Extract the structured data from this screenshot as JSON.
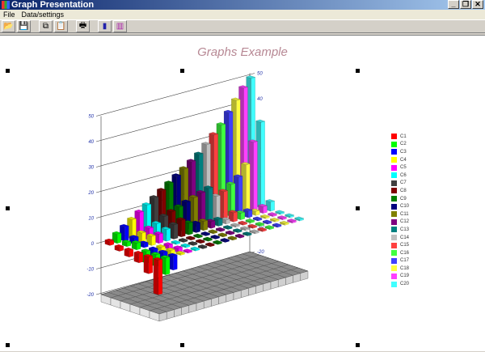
{
  "window": {
    "title": "Graph Presentation",
    "min": "_",
    "max": "❐",
    "close": "✕"
  },
  "menu": [
    "File",
    "Data/settings"
  ],
  "toolbar": [
    {
      "name": "open-icon",
      "glyph": "📂"
    },
    {
      "name": "save-icon",
      "glyph": "💾"
    },
    {
      "name": "copy-icon",
      "glyph": "⧉"
    },
    {
      "name": "paste-icon",
      "glyph": "📋"
    },
    {
      "name": "print-icon",
      "glyph": "🖶"
    },
    {
      "name": "bar-chart-3d-icon",
      "glyph": "▮"
    },
    {
      "name": "bar-chart-icon",
      "glyph": "▥"
    }
  ],
  "chart_data": {
    "type": "bar3d",
    "title": "Graphs Example",
    "ylim": [
      -20,
      50
    ],
    "yticks": [
      50,
      40,
      30,
      20,
      10,
      0,
      -10,
      -20
    ],
    "series": [
      {
        "name": "C1",
        "color": "#ff0000"
      },
      {
        "name": "C2",
        "color": "#00ff00"
      },
      {
        "name": "C3",
        "color": "#0000ff"
      },
      {
        "name": "C4",
        "color": "#ffff00"
      },
      {
        "name": "C5",
        "color": "#ff00ff"
      },
      {
        "name": "C6",
        "color": "#00ffff"
      },
      {
        "name": "C7",
        "color": "#404040"
      },
      {
        "name": "C8",
        "color": "#800000"
      },
      {
        "name": "C9",
        "color": "#008000"
      },
      {
        "name": "C10",
        "color": "#000080"
      },
      {
        "name": "C11",
        "color": "#808000"
      },
      {
        "name": "C12",
        "color": "#800080"
      },
      {
        "name": "C13",
        "color": "#008080"
      },
      {
        "name": "C14",
        "color": "#c0c0c0"
      },
      {
        "name": "C15",
        "color": "#ff4040"
      },
      {
        "name": "C16",
        "color": "#40ff40"
      },
      {
        "name": "C17",
        "color": "#4040ff"
      },
      {
        "name": "C18",
        "color": "#ffff40"
      },
      {
        "name": "C19",
        "color": "#ff40ff"
      },
      {
        "name": "C20",
        "color": "#40ffff"
      }
    ],
    "rows": [
      [
        1,
        3,
        5,
        7,
        9,
        11,
        13,
        15,
        17,
        19,
        21,
        23,
        25,
        28,
        31,
        34,
        38,
        42,
        46,
        49
      ],
      [
        -1,
        1,
        2,
        3,
        4,
        5,
        7,
        8,
        9,
        10,
        11,
        12,
        13,
        9,
        10,
        12,
        14,
        18,
        26,
        33
      ],
      [
        -2,
        2,
        1,
        3,
        3,
        4,
        5,
        6,
        4,
        3,
        3,
        2,
        2,
        1,
        3,
        2,
        2,
        1,
        2,
        3
      ],
      [
        -3,
        -4,
        -2,
        -1,
        -1,
        0,
        0,
        0,
        0,
        0,
        0,
        0,
        0,
        0,
        0,
        0,
        0,
        0,
        0,
        0
      ],
      [
        -6,
        -4,
        -3,
        -2,
        -1,
        0,
        0,
        0,
        0,
        0,
        0,
        0,
        0,
        0,
        0,
        0,
        0,
        0,
        0,
        0
      ],
      [
        -13,
        -6,
        -5,
        0,
        0,
        0,
        0,
        0,
        0,
        0,
        0,
        0,
        0,
        0,
        0,
        0,
        0,
        0,
        0,
        0
      ]
    ]
  }
}
